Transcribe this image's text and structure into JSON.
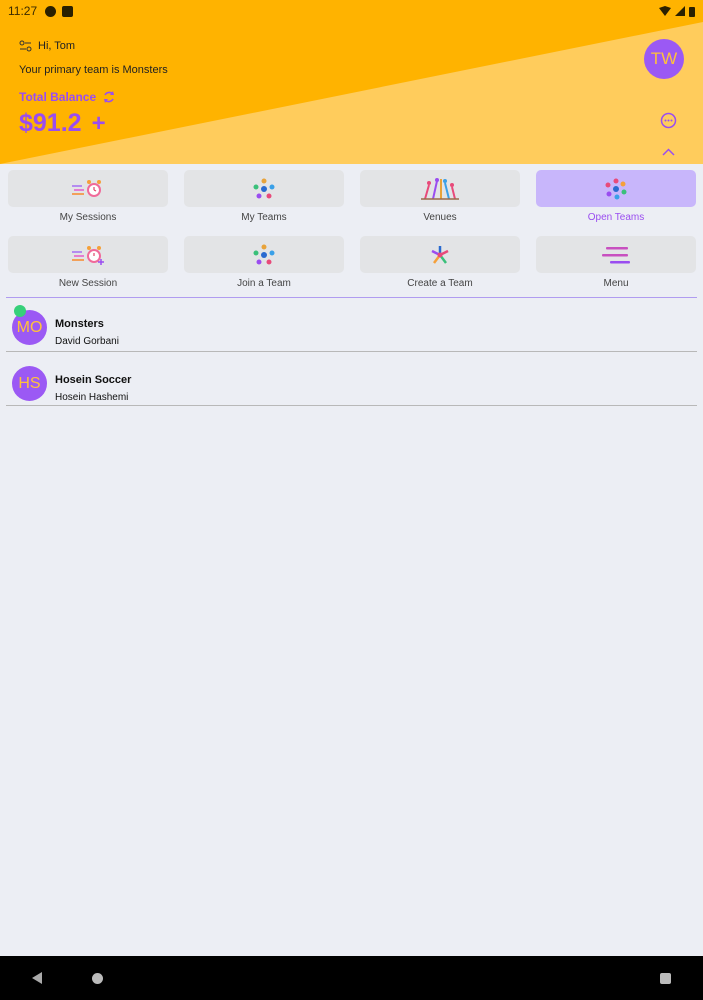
{
  "status_bar": {
    "time": "11:27"
  },
  "header": {
    "greeting": "Hi, Tom",
    "primary_team_text": "Your primary team is Monsters",
    "balance_label": "Total Balance",
    "balance_value": "$91.2",
    "add_label": "+",
    "avatar_initials": "TW",
    "colors": {
      "orange": "#ffb300",
      "light_orange": "#ffcc5c",
      "purple": "#9a4df0"
    }
  },
  "menu": {
    "row1": [
      {
        "label": "My Sessions",
        "icon": "alarm-clock-icon"
      },
      {
        "label": "My Teams",
        "icon": "team-circle-icon"
      },
      {
        "label": "Venues",
        "icon": "venue-people-icon"
      },
      {
        "label": "Open Teams",
        "icon": "open-teams-icon",
        "active": true
      }
    ],
    "row2": [
      {
        "label": "New Session",
        "icon": "alarm-plus-icon"
      },
      {
        "label": "Join a Team",
        "icon": "join-team-icon"
      },
      {
        "label": "Create a Team",
        "icon": "create-team-icon"
      },
      {
        "label": "Menu",
        "icon": "hamburger-icon"
      }
    ]
  },
  "teams": [
    {
      "initials": "MO",
      "name": "Monsters",
      "owner": "David  Gorbani",
      "online": true
    },
    {
      "initials": "HS",
      "name": "Hosein Soccer",
      "owner": "Hosein  Hashemi",
      "online": false
    }
  ]
}
